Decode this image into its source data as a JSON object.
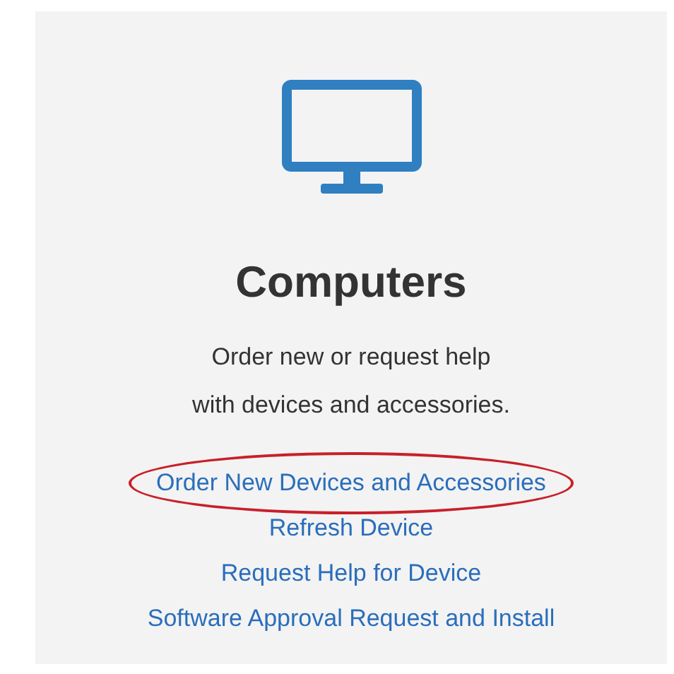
{
  "card": {
    "title": "Computers",
    "description": [
      "Order new or request help",
      "with devices and accessories."
    ],
    "links": [
      {
        "label": "Order New Devices and Accessories",
        "circled": true
      },
      {
        "label": "Refresh Device",
        "circled": false
      },
      {
        "label": "Request Help for Device",
        "circled": false
      },
      {
        "label": "Software Approval Request and Install",
        "circled": false
      }
    ]
  }
}
